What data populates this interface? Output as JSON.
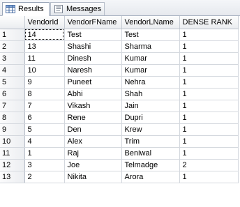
{
  "tabs": [
    {
      "label": "Results",
      "icon": "grid-icon",
      "active": true
    },
    {
      "label": "Messages",
      "icon": "messages-icon",
      "active": false
    }
  ],
  "grid": {
    "columns": [
      "VendorId",
      "VendorFName",
      "VendorLName",
      "DENSE RANK"
    ],
    "rows": [
      {
        "num": "1",
        "cells": [
          "14",
          "Test",
          "Test",
          "1"
        ]
      },
      {
        "num": "2",
        "cells": [
          "13",
          "Shashi",
          "Sharma",
          "1"
        ]
      },
      {
        "num": "3",
        "cells": [
          "11",
          "Dinesh",
          "Kumar",
          "1"
        ]
      },
      {
        "num": "4",
        "cells": [
          "10",
          "Naresh",
          "Kumar",
          "1"
        ]
      },
      {
        "num": "5",
        "cells": [
          "9",
          "Puneet",
          "Nehra",
          "1"
        ]
      },
      {
        "num": "6",
        "cells": [
          "8",
          "Abhi",
          "Shah",
          "1"
        ]
      },
      {
        "num": "7",
        "cells": [
          "7",
          "Vikash",
          "Jain",
          "1"
        ]
      },
      {
        "num": "8",
        "cells": [
          "6",
          "Rene",
          "Dupri",
          "1"
        ]
      },
      {
        "num": "9",
        "cells": [
          "5",
          "Den",
          "Krew",
          "1"
        ]
      },
      {
        "num": "10",
        "cells": [
          "4",
          "Alex",
          "Trim",
          "1"
        ]
      },
      {
        "num": "11",
        "cells": [
          "1",
          "Raj",
          "Beniwal",
          "1"
        ]
      },
      {
        "num": "12",
        "cells": [
          "3",
          "Joe",
          "Telmadge",
          "2"
        ]
      },
      {
        "num": "13",
        "cells": [
          "2",
          "Nikita",
          "Arora",
          "1"
        ]
      }
    ]
  },
  "colors": {
    "header_bg": "#ebedf0",
    "grid_line": "#d4d8de",
    "tab_border": "#9aa6b8"
  }
}
